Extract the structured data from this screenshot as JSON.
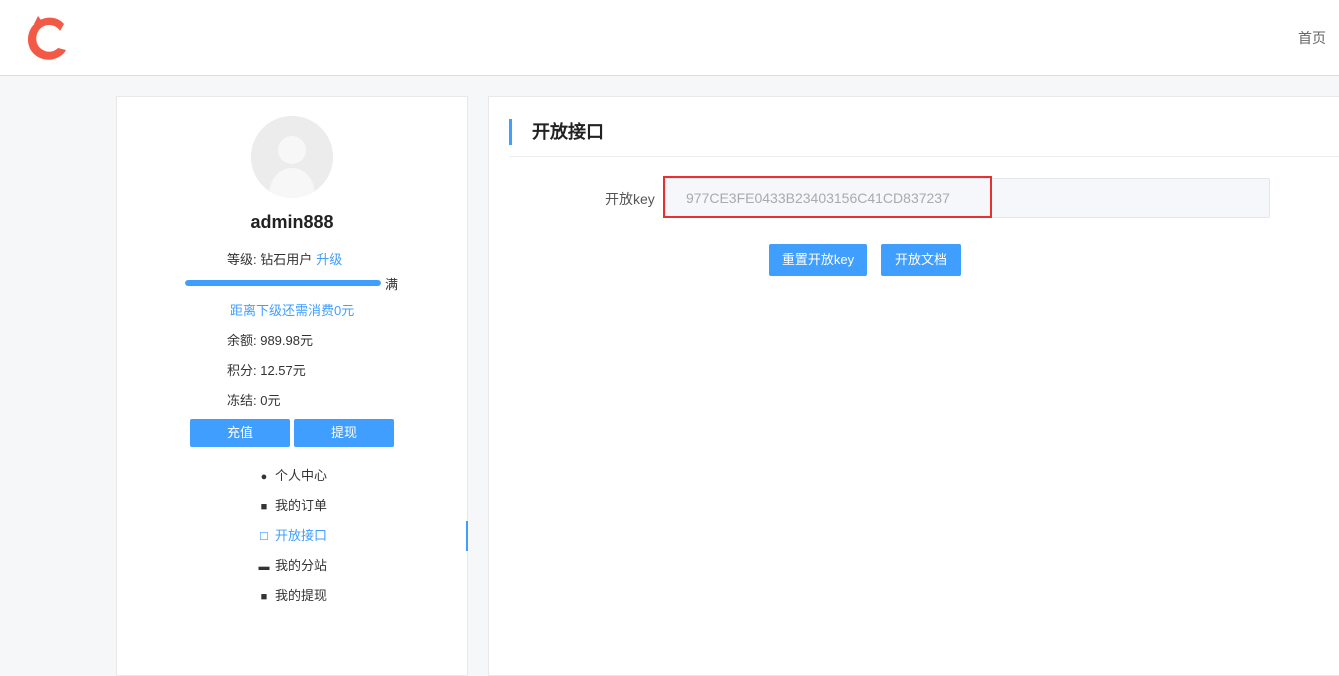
{
  "header": {
    "logo_icon": "brand-logo-icon",
    "nav_home": "首页"
  },
  "user": {
    "username": "admin888",
    "level_label": "等级: 钻石用户",
    "upgrade_link": "升级",
    "progress_percent": 100,
    "progress_text": "满",
    "next_level_text": "距离下级还需消费0元",
    "balance": "余额: 989.98元",
    "points": "积分: 12.57元",
    "frozen": "冻结: 0元",
    "recharge_button": "充值",
    "withdraw_button": "提现"
  },
  "menu": [
    {
      "label": "个人中心",
      "icon": "user-icon"
    },
    {
      "label": "我的订单",
      "icon": "clipboard-icon"
    },
    {
      "label": "开放接口",
      "icon": "api-icon",
      "active": true
    },
    {
      "label": "我的分站",
      "icon": "store-icon"
    },
    {
      "label": "我的提现",
      "icon": "wallet-icon"
    }
  ],
  "main": {
    "title": "开放接口",
    "key_label": "开放key",
    "key_value": "977CE3FE0433B23403156C41CD837237",
    "reset_button": "重置开放key",
    "docs_button": "开放文档"
  },
  "colors": {
    "accent": "#409eff",
    "highlight": "#e5312f",
    "logo": "#f25a45"
  }
}
